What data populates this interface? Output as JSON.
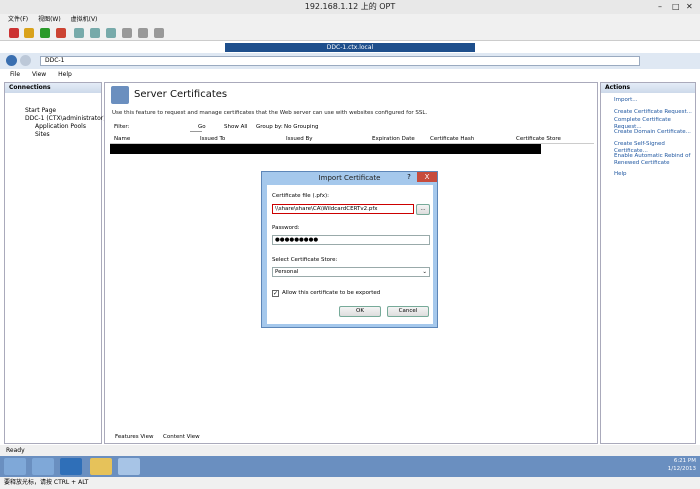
{
  "vm": {
    "title": "192.168.1.12 上的 OPT",
    "menu": [
      "文件(F)",
      "视图(W)",
      "虚拟机(V)"
    ],
    "window_controls": [
      "–",
      "□",
      "✕"
    ]
  },
  "rdp": {
    "title": "DDC-1.ctx.local"
  },
  "address": {
    "path": "DDC-1"
  },
  "iis_menu": [
    "File",
    "View",
    "Help"
  ],
  "connections": {
    "header": "Connections",
    "items": [
      "Start Page",
      "DDC-1 (CTX\\administrator)",
      "Application Pools",
      "Sites"
    ]
  },
  "main": {
    "title": "Server Certificates",
    "description": "Use this feature to request and manage certificates that the Web server can use with websites configured for SSL.",
    "filter_label": "Filter:",
    "go_label": "Go",
    "show_all_label": "Show All",
    "group_by_label": "Group by:",
    "group_by_value": "No Grouping",
    "columns": [
      "Name",
      "Issued To",
      "Issued By",
      "Expiration Date",
      "Certificate Hash",
      "Certificate Store"
    ],
    "features_view": "Features View",
    "content_view": "Content View"
  },
  "actions": {
    "header": "Actions",
    "items": [
      "Import...",
      "Create Certificate Request...",
      "Complete Certificate Request...",
      "Create Domain Certificate...",
      "Create Self-Signed Certificate...",
      "Enable Automatic Rebind of Renewed Certificate",
      "Help"
    ]
  },
  "status": "Ready",
  "tray": {
    "time": "6:21 PM",
    "date": "1/12/2013"
  },
  "bottom_hint": "要释放光标，请按 CTRL + ALT",
  "dialog": {
    "title": "Import Certificate",
    "file_label": "Certificate file (.pfx):",
    "file_value": "\\\\share\\share\\CA\\WildcardCERTv2.pfx",
    "browse_label": "...",
    "password_label": "Password:",
    "password_value": "●●●●●●●●●",
    "store_label": "Select Certificate Store:",
    "store_value": "Personal",
    "export_label": "Allow this certificate to be exported",
    "ok_label": "OK",
    "cancel_label": "Cancel",
    "help_glyph": "?",
    "close_glyph": "X"
  }
}
